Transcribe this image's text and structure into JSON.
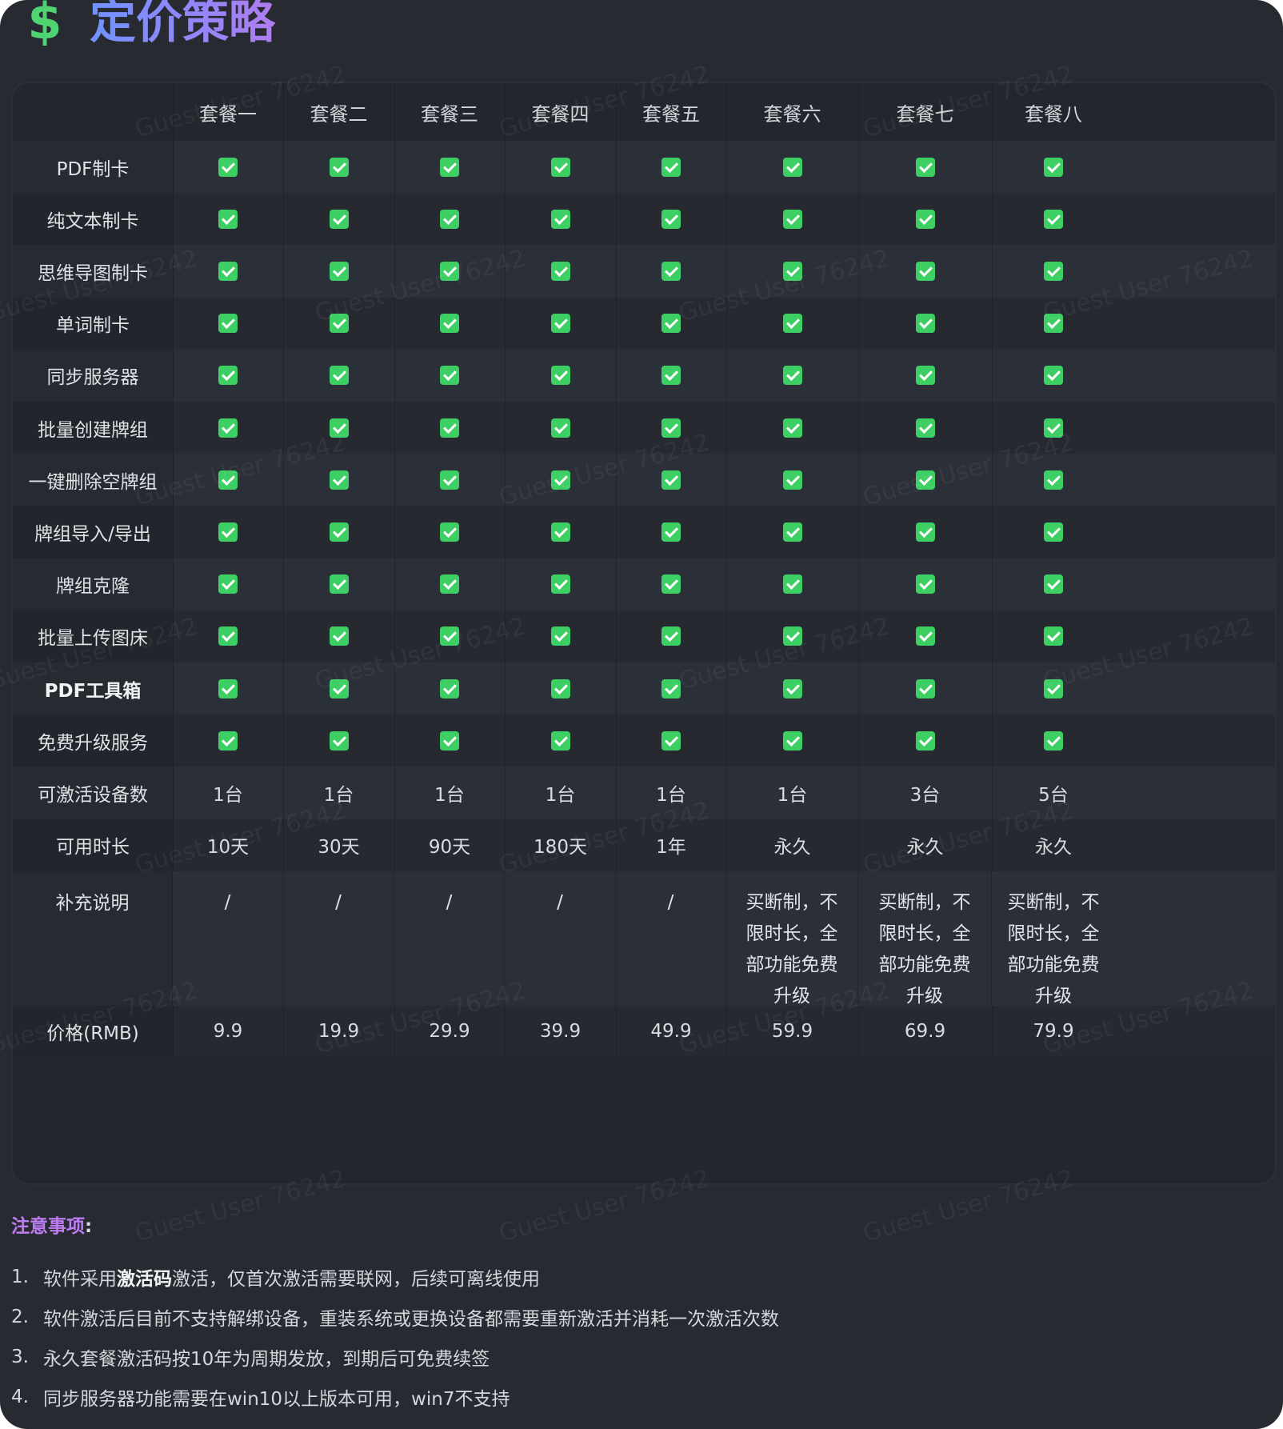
{
  "title": {
    "icon": "dollar-sign-icon",
    "text": "定价策略"
  },
  "table": {
    "columns": [
      "套餐一",
      "套餐二",
      "套餐三",
      "套餐四",
      "套餐五",
      "套餐六",
      "套餐七",
      "套餐八"
    ],
    "feature_rows": [
      {
        "label": "PDF制卡",
        "bold": false
      },
      {
        "label": "纯文本制卡",
        "bold": false
      },
      {
        "label": "思维导图制卡",
        "bold": false
      },
      {
        "label": "单词制卡",
        "bold": false
      },
      {
        "label": "同步服务器",
        "bold": false
      },
      {
        "label": "批量创建牌组",
        "bold": false
      },
      {
        "label": "一键删除空牌组",
        "bold": false
      },
      {
        "label": "牌组导入/导出",
        "bold": false
      },
      {
        "label": "牌组克隆",
        "bold": false
      },
      {
        "label": "批量上传图床",
        "bold": false
      },
      {
        "label": "PDF工具箱",
        "bold": true
      },
      {
        "label": "免费升级服务",
        "bold": false
      }
    ],
    "check_icon": "checkbox-checked-icon",
    "check_color": "#3dcf63",
    "devices": {
      "label": "可激活设备数",
      "values": [
        "1台",
        "1台",
        "1台",
        "1台",
        "1台",
        "1台",
        "3台",
        "5台"
      ]
    },
    "duration": {
      "label": "可用时长",
      "values": [
        "10天",
        "30天",
        "90天",
        "180天",
        "1年",
        "永久",
        "永久",
        "永久"
      ]
    },
    "notes": {
      "label": "补充说明",
      "values": [
        "/",
        "/",
        "/",
        "/",
        "/",
        "买断制，不限时长，全部功能免费升级",
        "买断制，不限时长，全部功能免费升级",
        "买断制，不限时长，全部功能免费升级"
      ]
    },
    "price": {
      "label": "价格(RMB)",
      "values": [
        "9.9",
        "19.9",
        "29.9",
        "39.9",
        "49.9",
        "59.9",
        "69.9",
        "79.9"
      ]
    }
  },
  "notices": {
    "title": "注意事项",
    "colon": ":",
    "items": [
      {
        "num": "1.",
        "pre": "软件采用",
        "bold": "激活码",
        "post": "激活，仅首次激活需要联网，后续可离线使用"
      },
      {
        "num": "2.",
        "pre": "软件激活后目前不支持解绑设备，重装系统或更换设备都需要重新激活并消耗一次激活次数",
        "bold": "",
        "post": ""
      },
      {
        "num": "3.",
        "pre": "永久套餐激活码按10年为周期发放，到期后可免费续签",
        "bold": "",
        "post": ""
      },
      {
        "num": "4.",
        "pre": "同步服务器功能需要在win10以上版本可用，win7不支持",
        "bold": "",
        "post": ""
      }
    ]
  },
  "watermark": "Guest User 76242",
  "colors": {
    "background": "#272b31",
    "title_gradient_start": "#6f93ff",
    "title_gradient_end": "#b07cf2",
    "dollar": "#4fd471",
    "notice_title": "#c07cf5"
  }
}
